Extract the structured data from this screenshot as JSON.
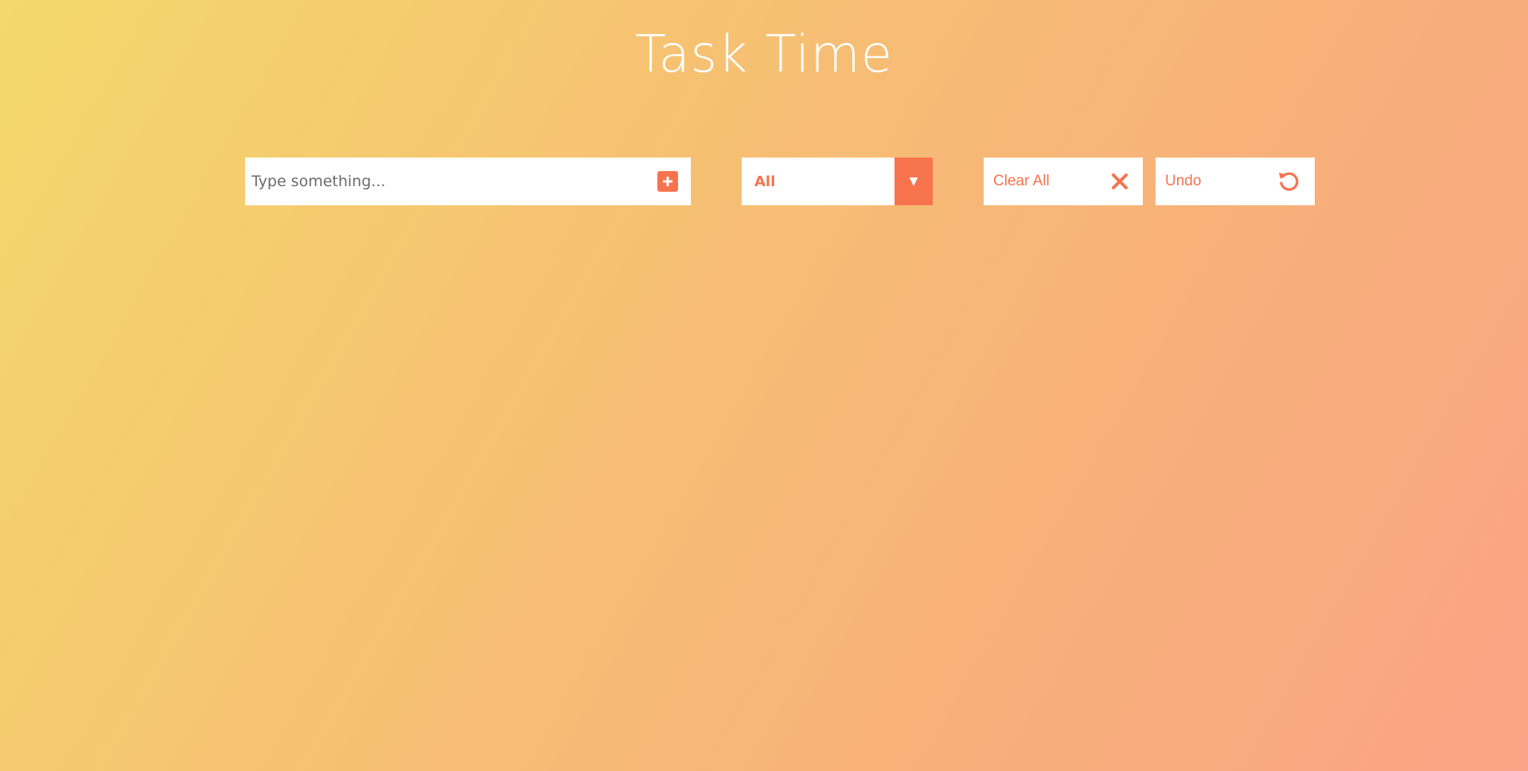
{
  "app": {
    "title": "Task Time"
  },
  "todo_form": {
    "placeholder": "Type something...",
    "value": "",
    "add_icon": "plus-square-icon"
  },
  "filter": {
    "selected": "All",
    "arrow_icon": "caret-down-icon"
  },
  "actions": {
    "clear_label": "Clear All",
    "clear_icon": "close-icon",
    "undo_label": "Undo",
    "undo_icon": "undo-icon"
  },
  "colors": {
    "accent": "#f6734e",
    "gradient_start": "#f3d86b",
    "gradient_end": "#faa385",
    "panel": "#ffffff"
  }
}
